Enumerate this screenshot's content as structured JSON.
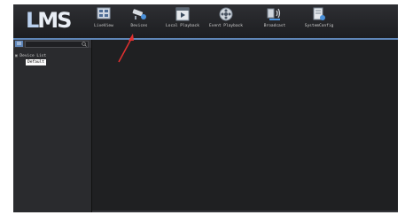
{
  "app": {
    "logo_prefix": "L",
    "logo_suffix": "MS"
  },
  "nav": [
    {
      "id": "liveview",
      "label": "LiveView",
      "icon": "monitor-grid-icon"
    },
    {
      "id": "devices",
      "label": "Devices",
      "icon": "camera-icon"
    },
    {
      "id": "local-playback",
      "label": "Local Playback",
      "icon": "film-play-icon"
    },
    {
      "id": "event-playback",
      "label": "Event Playback",
      "icon": "reel-icon"
    },
    {
      "id": "broadcast",
      "label": "Broadcast",
      "icon": "broadcast-icon"
    },
    {
      "id": "systemconfig",
      "label": "SystemConfig",
      "icon": "config-icon"
    }
  ],
  "sidebar": {
    "tree_root": "Device List",
    "tree_child": "Default"
  },
  "colors": {
    "accent": "#5f86b8",
    "annotation": "#e23030",
    "background": "#1b1c1f"
  }
}
